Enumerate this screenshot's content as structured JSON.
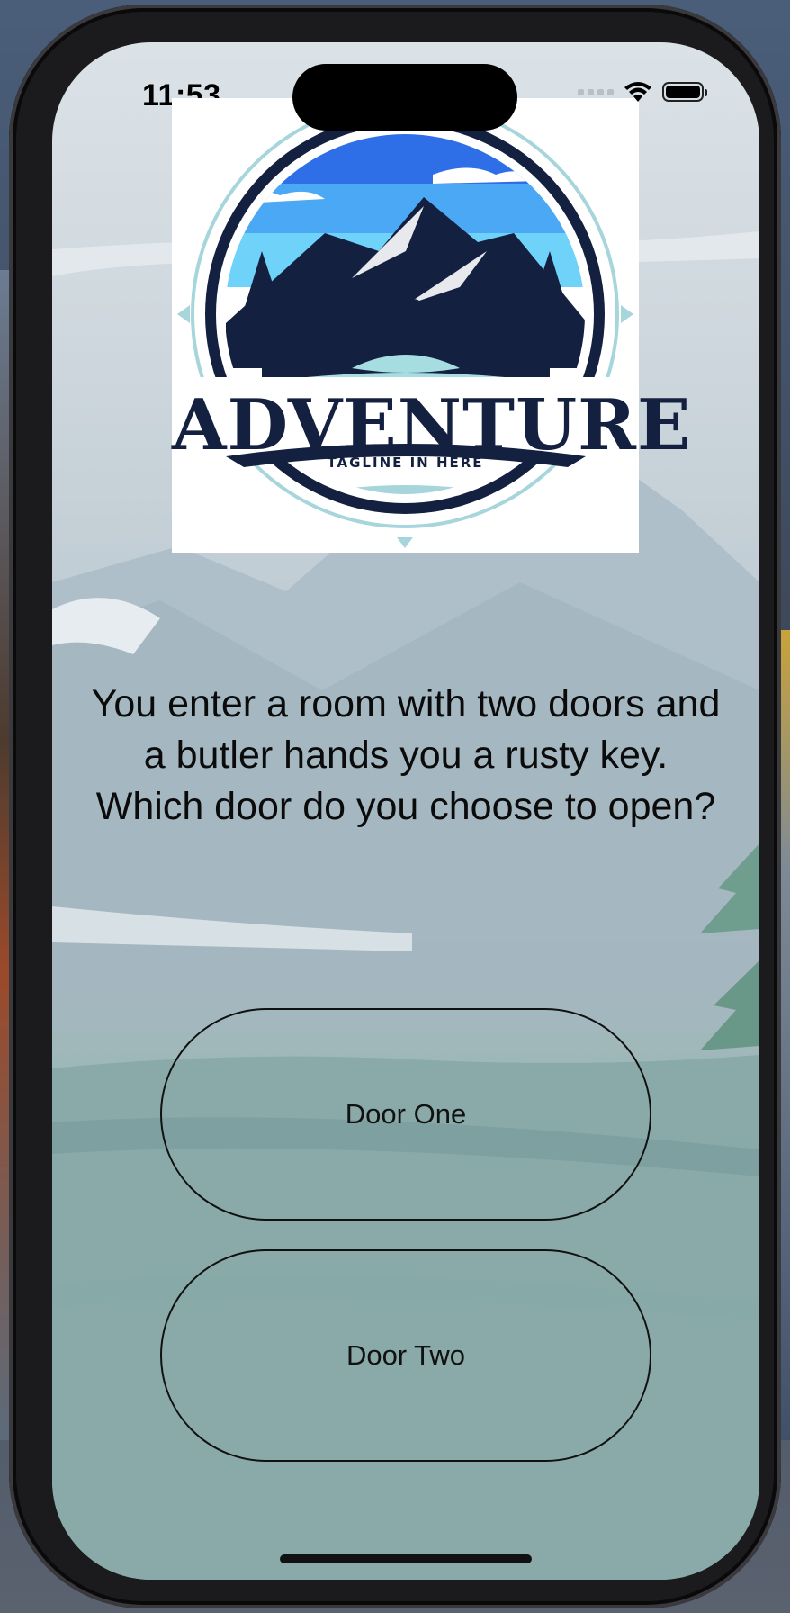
{
  "status_bar": {
    "time": "11:53",
    "icons": [
      "cellular-dots-icon",
      "wifi-icon",
      "battery-icon"
    ]
  },
  "logo": {
    "title": "ADVENTURE",
    "tagline": "TAGLINE IN HERE",
    "colors": {
      "navy": "#142040",
      "sky": "#3d8cf0",
      "water": "#a6dde0"
    }
  },
  "story": {
    "text": "You enter a room with two doors and a butler hands you a rusty key. Which door do you choose to open?"
  },
  "choices": [
    {
      "label": "Door One"
    },
    {
      "label": "Door Two"
    }
  ]
}
